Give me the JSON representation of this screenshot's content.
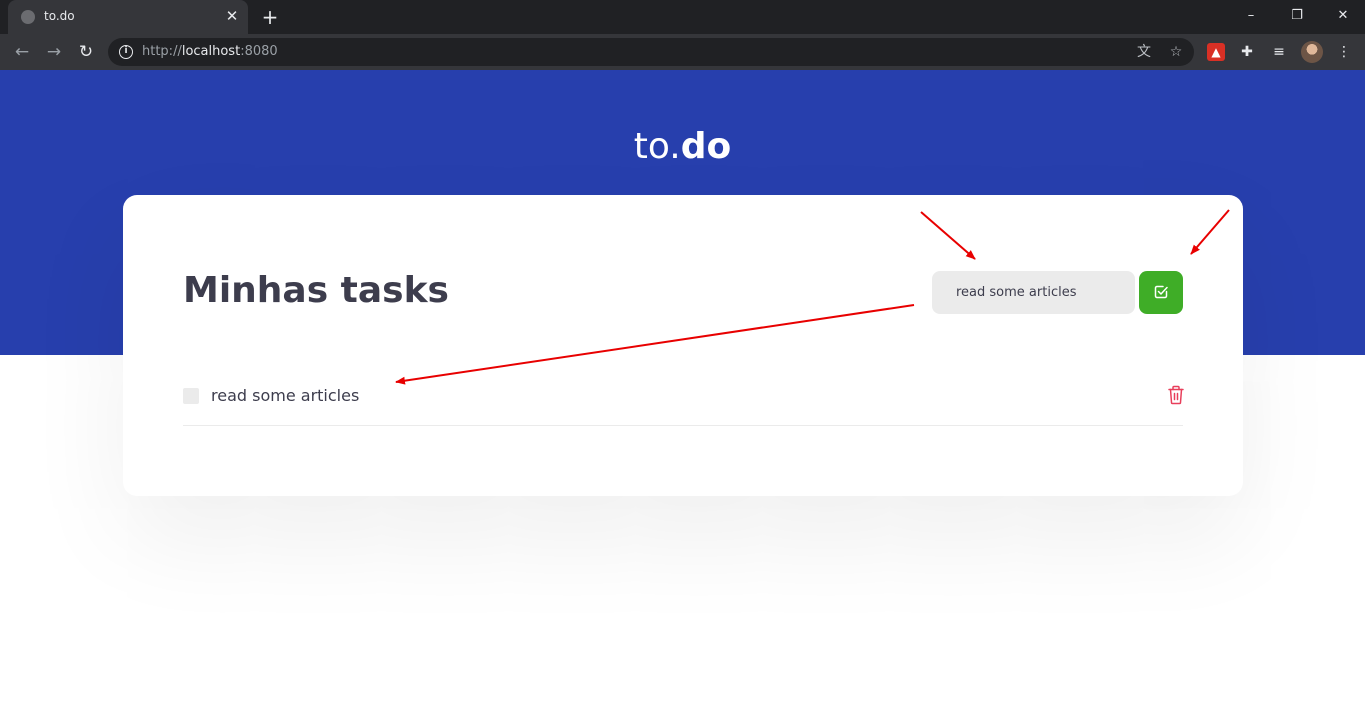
{
  "browser": {
    "tab_title": "to.do",
    "tab_close": "✕",
    "new_tab": "+",
    "url_scheme": "http://",
    "url_host": "localhost",
    "url_port": ":8080",
    "window_controls": {
      "minimize": "–",
      "restore": "❐",
      "close": "✕"
    }
  },
  "app": {
    "brand_light": "to.",
    "brand_bold": "do",
    "title": "Minhas tasks",
    "new_task_value": "read some articles",
    "tasks": [
      {
        "text": "read some articles",
        "done": false
      }
    ]
  },
  "colors": {
    "header_blue": "#273fad",
    "add_green": "#3fad27",
    "trash_red": "#e83f5b",
    "annotation_red": "#e80000"
  }
}
